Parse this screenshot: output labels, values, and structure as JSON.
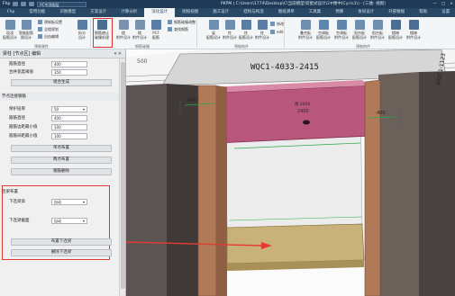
{
  "titlebar": {
    "app_label": "Fhp",
    "project_combo": "PC专项图层",
    "title": "PKPM | C:\\Users\\1774\\Desktop\\C\\当前模型\\装配式设计\\2#楼中(Cyc\\s1\\)  - [三维: 视图]",
    "minimize": "—",
    "maximize": "□",
    "close": "×"
  },
  "tabs": [
    "Fhp",
    "常用功能",
    "识图模型",
    "方案设计",
    "计算分析",
    "深化设计",
    "图纸视图",
    "施工设计",
    "结构与构造",
    "图纸清单",
    "工具集",
    "预算",
    "协同设计",
    "外部数据",
    "帮助",
    "设置"
  ],
  "active_tab_index": 5,
  "ribbon": {
    "big_buttons": [
      {
        "label": "现浇\n配筋设计",
        "icon": "rebar-design-icon"
      },
      {
        "label": "智能配筋\n图设计",
        "icon": "smart-rebar-icon"
      },
      {
        "label": "拆分\n设计",
        "icon": "split-design-icon"
      },
      {
        "label": "钢筋避让\n碰撞处理",
        "icon": "rebar-avoid-icon"
      },
      {
        "label": "楼\n附件设计",
        "icon": "floor-parts-icon"
      },
      {
        "label": "楼\n附件设计",
        "icon": "floor-parts-2-icon"
      },
      {
        "label": "PCF\n配筋",
        "icon": "pcf-icon"
      },
      {
        "label": "梁\n配筋设计",
        "icon": "beam-icon"
      },
      {
        "label": "柱\n附件设计",
        "icon": "column-icon"
      },
      {
        "label": "柱\n配筋设计",
        "icon": "column-rebar-icon"
      },
      {
        "label": "柱\n附件设计",
        "icon": "column-parts-icon"
      },
      {
        "label": "叠合板\n附件设计",
        "icon": "slab-parts-icon"
      },
      {
        "label": "空调板\n配筋设计",
        "icon": "ac-board-icon"
      },
      {
        "label": "空调板\n附件设计",
        "icon": "ac-parts-icon"
      },
      {
        "label": "阳台板\n配筋设计",
        "icon": "balcony-icon"
      },
      {
        "label": "阳台板\n附件设计",
        "icon": "balcony-parts-icon"
      },
      {
        "label": "楼梯\n配筋设计",
        "icon": "stair-icon"
      },
      {
        "label": "楼梯\n附件设计",
        "icon": "stair-parts-icon"
      }
    ],
    "small_buttons": [
      "预制板设置",
      "全楼规划",
      "自由编辑",
      "钢筋碰撞调整",
      "查找钢筋",
      "修改",
      "edit"
    ],
    "groups": [
      "预制属性",
      "钢筋碰撞",
      "预制构件",
      "预制构件"
    ]
  },
  "panel": {
    "title": "梁柱 [节点区] 编辑",
    "pin": "▾ ✕",
    "rows_top": [
      {
        "label": "箍筋直径",
        "value": "400"
      },
      {
        "label": "合并宽度阈值",
        "value": "350"
      }
    ],
    "btn_top": "组合生成",
    "section1": "节点连接钢筋",
    "rows_mid": [
      {
        "label": "保护层厚",
        "value": "50",
        "dropdown": true
      },
      {
        "label": "箍筋直径",
        "value": "400",
        "dropdown": false
      },
      {
        "label": "箍筋边距最小值",
        "value": "100",
        "dropdown": false
      },
      {
        "label": "箍筋间距最小值",
        "value": "100",
        "dropdown": false
      }
    ],
    "btns_mid": [
      "单点布置",
      "两点布置",
      "钢筋删除"
    ],
    "section2": "连梁布置",
    "rows_bot": [
      {
        "label": "下连梁高",
        "value": "自动"
      },
      {
        "label": "下连梁截面",
        "value": "自动"
      }
    ],
    "btns_bot": [
      "布置下连梁",
      "删除下连梁"
    ]
  },
  "viewport": {
    "label_top": "WQC1-4033-2415",
    "label_dim": "2400",
    "label_mid": "图 2400",
    "label_left_dim": "400",
    "label_right_dim": "400",
    "label_side": "WQC1-1123",
    "label_small": "500"
  },
  "colors": {
    "accent_red": "#e23b31",
    "beam_magenta": "#b9567b",
    "column_brown": "#b07a58",
    "lower_beam_tan": "#c9b27a",
    "wall_dark": "#6a5d57"
  }
}
